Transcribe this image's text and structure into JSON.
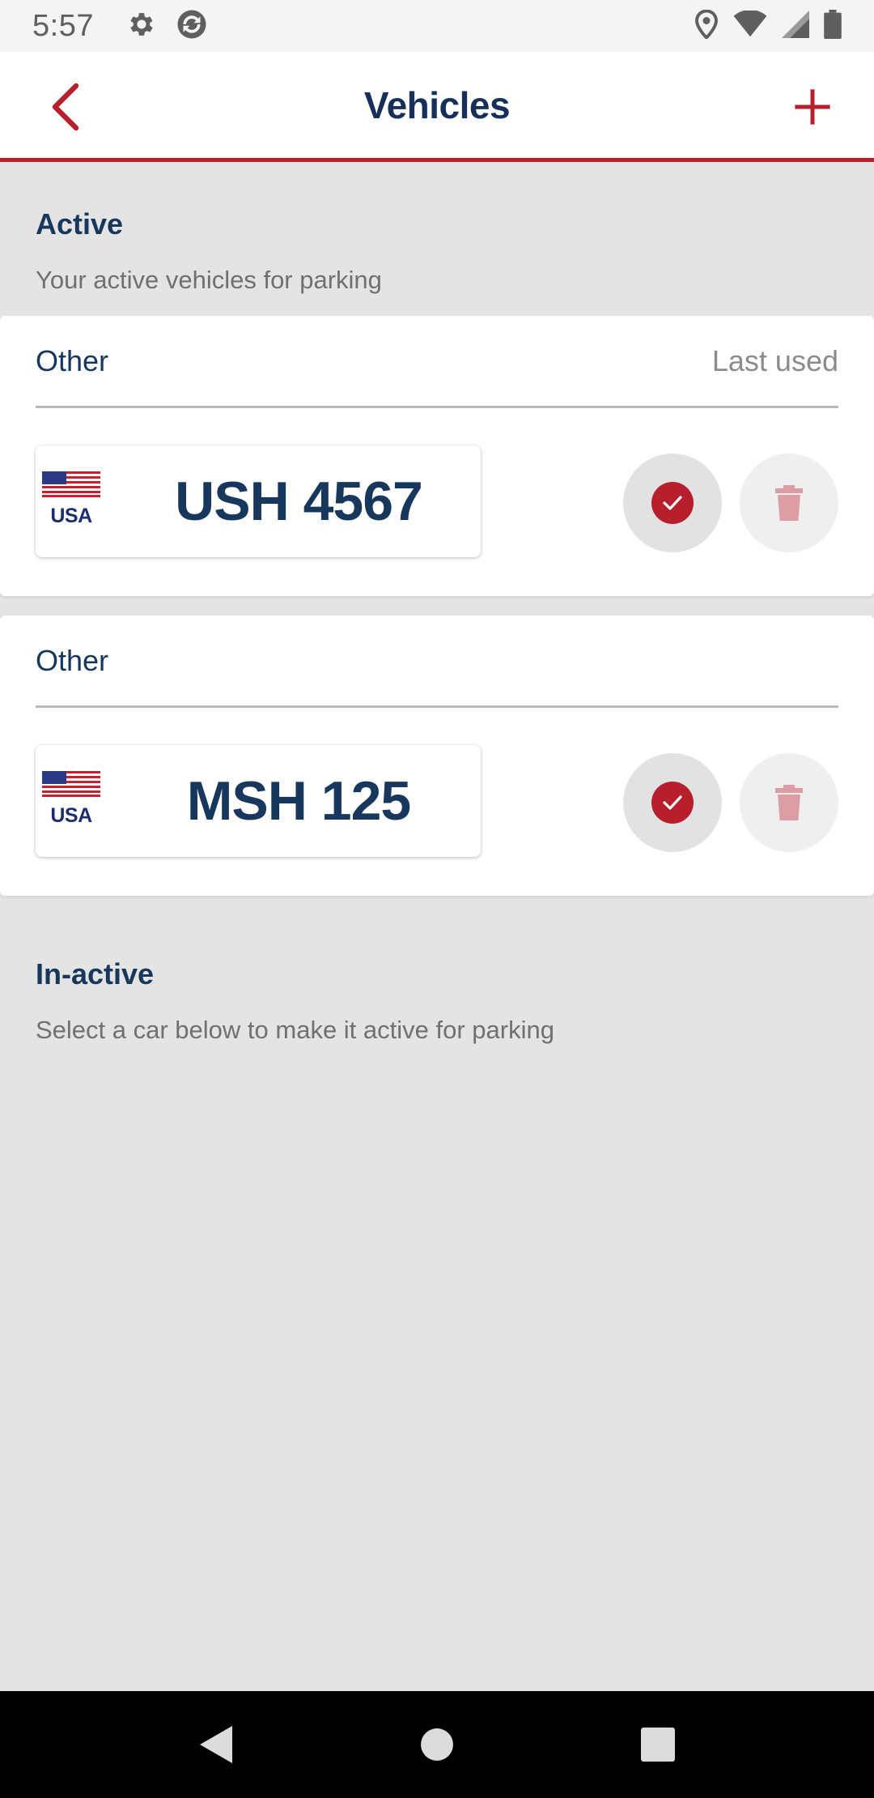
{
  "status_bar": {
    "time": "5:57",
    "left_icons": [
      "gear-icon",
      "sync-icon"
    ],
    "right_icons": [
      "location-icon",
      "wifi-icon",
      "signal-icon",
      "battery-icon"
    ]
  },
  "header": {
    "title": "Vehicles",
    "back_icon": "chevron-left-icon",
    "add_icon": "plus-icon",
    "accent_color": "#b61f2b"
  },
  "active_section": {
    "title": "Active",
    "subtitle": "Your active vehicles for parking"
  },
  "vehicles": [
    {
      "type": "Other",
      "last_used_label": "Last used",
      "country_label": "USA",
      "plate": "USH 4567"
    },
    {
      "type": "Other",
      "last_used_label": "",
      "country_label": "USA",
      "plate": "MSH 125"
    }
  ],
  "inactive_section": {
    "title": "In-active",
    "subtitle": "Select a car below to make it active for parking"
  },
  "nav_bar": {
    "icons": [
      "back-triangle-icon",
      "home-circle-icon",
      "recents-square-icon"
    ]
  }
}
